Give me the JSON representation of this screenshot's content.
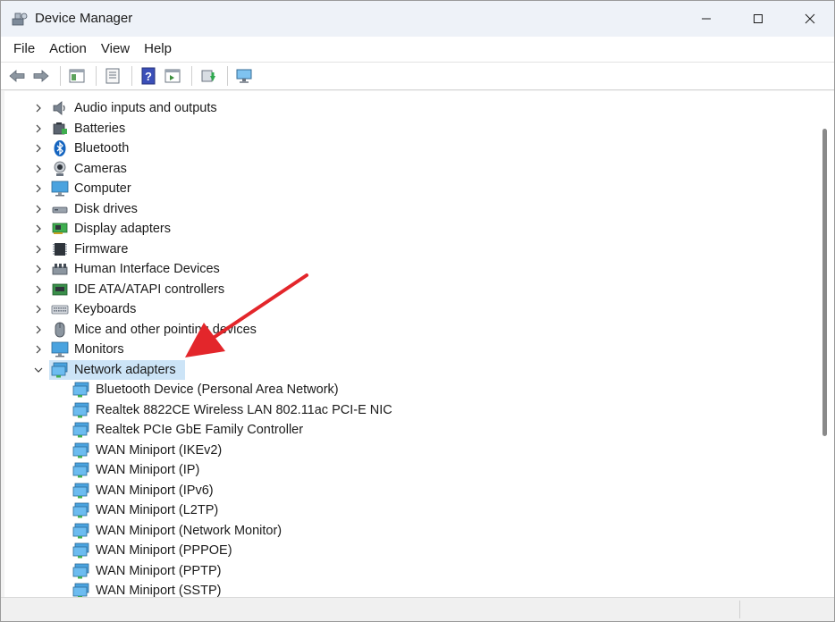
{
  "window": {
    "title": "Device Manager"
  },
  "menu": {
    "items": [
      "File",
      "Action",
      "View",
      "Help"
    ]
  },
  "toolbar": {
    "buttons": [
      {
        "icon": "back-arrow-icon"
      },
      {
        "icon": "forward-arrow-icon"
      },
      {
        "icon": "show-hide-console-tree-icon"
      },
      {
        "icon": "properties-icon"
      },
      {
        "icon": "help-icon"
      },
      {
        "icon": "action-pane-icon"
      },
      {
        "icon": "update-driver-icon"
      },
      {
        "icon": "scan-hardware-changes-icon"
      }
    ]
  },
  "tree": {
    "categories": [
      {
        "label": "Audio inputs and outputs",
        "icon": "speaker-icon",
        "expanded": false
      },
      {
        "label": "Batteries",
        "icon": "battery-icon",
        "expanded": false
      },
      {
        "label": "Bluetooth",
        "icon": "bluetooth-icon",
        "expanded": false
      },
      {
        "label": "Cameras",
        "icon": "camera-icon",
        "expanded": false
      },
      {
        "label": "Computer",
        "icon": "computer-icon",
        "expanded": false
      },
      {
        "label": "Disk drives",
        "icon": "disk-drive-icon",
        "expanded": false
      },
      {
        "label": "Display adapters",
        "icon": "display-adapter-icon",
        "expanded": false
      },
      {
        "label": "Firmware",
        "icon": "firmware-icon",
        "expanded": false
      },
      {
        "label": "Human Interface Devices",
        "icon": "hid-icon",
        "expanded": false
      },
      {
        "label": "IDE ATA/ATAPI controllers",
        "icon": "ide-controller-icon",
        "expanded": false
      },
      {
        "label": "Keyboards",
        "icon": "keyboard-icon",
        "expanded": false
      },
      {
        "label": "Mice and other pointing devices",
        "icon": "mouse-icon",
        "expanded": false
      },
      {
        "label": "Monitors",
        "icon": "monitor-icon",
        "expanded": false
      },
      {
        "label": "Network adapters",
        "icon": "network-adapter-icon",
        "expanded": true,
        "selected": true
      }
    ],
    "network_adapters": [
      "Bluetooth Device (Personal Area Network)",
      "Realtek 8822CE Wireless LAN 802.11ac PCI-E NIC",
      "Realtek PCIe GbE Family Controller",
      "WAN Miniport (IKEv2)",
      "WAN Miniport (IP)",
      "WAN Miniport (IPv6)",
      "WAN Miniport (L2TP)",
      "WAN Miniport (Network Monitor)",
      "WAN Miniport (PPPOE)",
      "WAN Miniport (PPTP)",
      "WAN Miniport (SSTP)"
    ]
  },
  "colors": {
    "selection": "#cce4f7",
    "annotation_arrow": "#e3262b",
    "titlebar": "#eef2f8"
  }
}
